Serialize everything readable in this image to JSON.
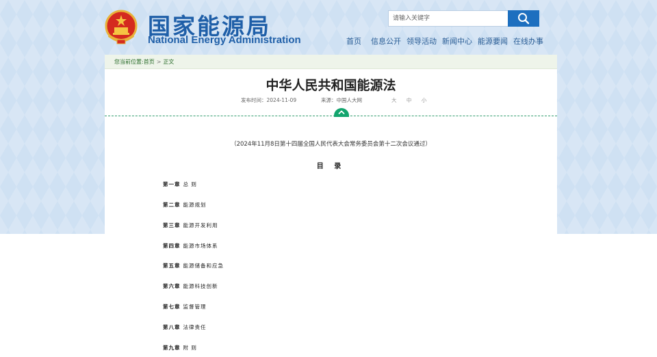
{
  "header": {
    "title_cn": "国家能源局",
    "title_en": "National Energy Administration",
    "search_placeholder": "请输入关键字",
    "nav": [
      "首页",
      "信息公开",
      "领导活动",
      "新闻中心",
      "能源要闻",
      "在线办事"
    ]
  },
  "breadcrumb": {
    "prefix": "您当前位置:",
    "home": "首页",
    "separator": ">",
    "current": "正文"
  },
  "article": {
    "title": "中华人民共和国能源法",
    "date_label": "发布时间：2024-11-09",
    "source_label": "来源：中国人大网",
    "font_size_options": "大 中 小",
    "subtitle": "（2024年11月8日第十四届全国人民代表大会常务委员会第十二次会议通过）",
    "toc_title": "目 录",
    "toc": [
      {
        "num": "第一章",
        "title": "总 则"
      },
      {
        "num": "第二章",
        "title": "能源规划"
      },
      {
        "num": "第三章",
        "title": "能源开发利用"
      },
      {
        "num": "第四章",
        "title": "能源市场体系"
      },
      {
        "num": "第五章",
        "title": "能源储备和应急"
      },
      {
        "num": "第六章",
        "title": "能源科技创新"
      },
      {
        "num": "第七章",
        "title": "监督管理"
      },
      {
        "num": "第八章",
        "title": "法律责任"
      },
      {
        "num": "第九章",
        "title": "附 则"
      }
    ]
  },
  "colors": {
    "brand_blue": "#1f5fa8",
    "search_button": "#1d6fbf",
    "accent_green": "#13a56e",
    "background_blue": "#cfe1f3"
  }
}
